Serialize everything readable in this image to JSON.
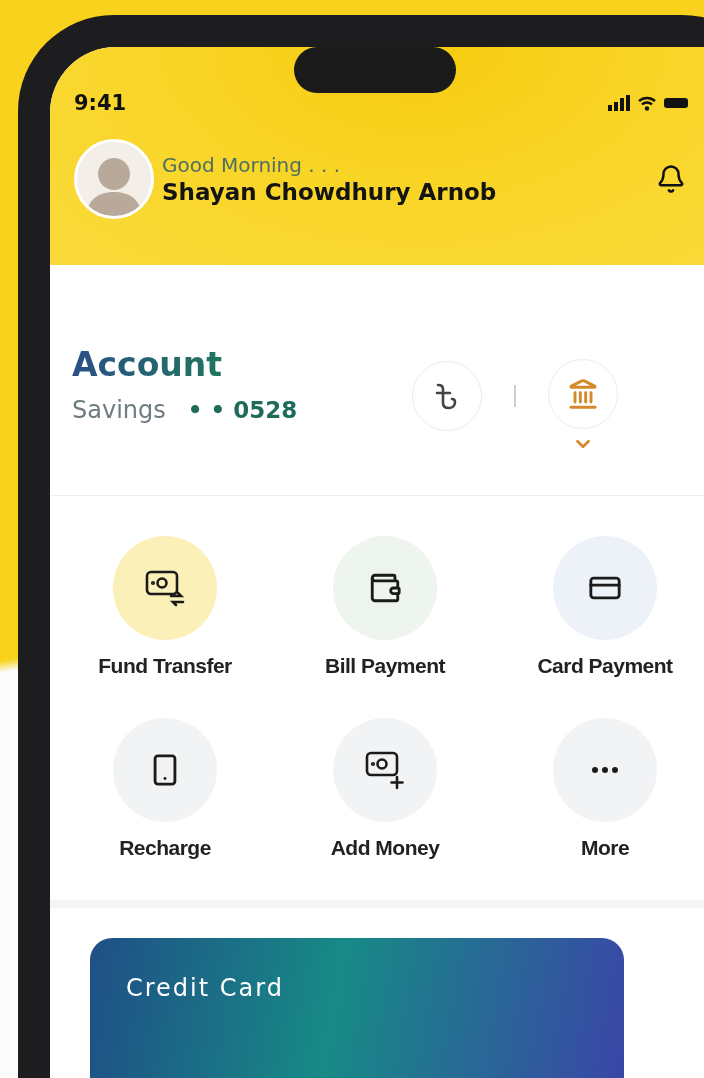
{
  "status_bar": {
    "time": "9:41"
  },
  "header": {
    "greeting": "Good Morning . . .",
    "name": "Shayan Chowdhury Arnob"
  },
  "account": {
    "title": "Account",
    "type": "Savings",
    "masked_number": "• • 0528"
  },
  "actions": [
    {
      "label": "Fund Transfer",
      "kind": "transfer",
      "color": "#fbf1b8"
    },
    {
      "label": "Bill Payment",
      "kind": "wallet",
      "color": "#eef4ee"
    },
    {
      "label": "Card Payment",
      "kind": "card",
      "color": "#ecf2f8"
    },
    {
      "label": "Recharge",
      "kind": "phone",
      "color": "#f1f3f4"
    },
    {
      "label": "Add Money",
      "kind": "add",
      "color": "#f1f3f4"
    },
    {
      "label": "More",
      "kind": "more",
      "color": "#f1f3f4"
    }
  ],
  "card": {
    "title": "Credit Card"
  }
}
